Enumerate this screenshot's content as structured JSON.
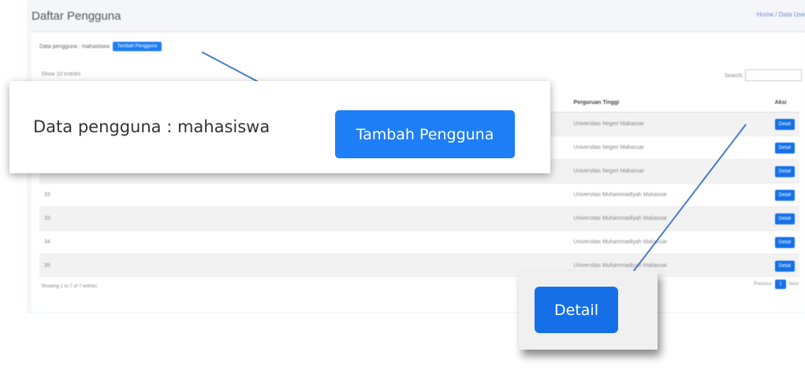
{
  "page": {
    "title": "Daftar Pengguna",
    "breadcrumb": "Home / Data Use"
  },
  "card": {
    "label": "Data pengguna : mahasiswa",
    "add_button": "Tambah Pengguna",
    "show_entries": "Show 10 entries",
    "search_label": "Search:",
    "search_value": ""
  },
  "table": {
    "headers": [
      "",
      "",
      "",
      "",
      "Perguruan Tinggi",
      "Aksi"
    ],
    "rows": [
      [
        "",
        "",
        "",
        "",
        "Universitas Negeri Makassar",
        "Detail"
      ],
      [
        "",
        "",
        "",
        "",
        "Universitas Negeri Makassar",
        "Detail"
      ],
      [
        "",
        "",
        "",
        "",
        "Universitas Negeri Makassar",
        "Detail"
      ],
      [
        "33",
        "",
        "",
        "",
        "Universitas Muhammadiyah Makassar",
        "Detail"
      ],
      [
        "33",
        "",
        "",
        "",
        "Universitas Muhammadiyah Makassar",
        "Detail"
      ],
      [
        "34",
        "",
        "",
        "",
        "Universitas Muhammadiyah Makassar",
        "Detail"
      ],
      [
        "35",
        "",
        "",
        "",
        "Universitas Muhammadiyah Makassar",
        "Detail"
      ]
    ]
  },
  "footer": {
    "showing": "Showing 1 to 7 of 7 entries",
    "prev": "Previous",
    "page": "1",
    "next": "Next"
  },
  "callouts": {
    "zoom_label": "Data pengguna : mahasiswa",
    "zoom_button": "Tambah Pengguna",
    "detail_button": "Detail"
  },
  "colors": {
    "primary": "#1e7ef5",
    "connector": "#4a7cc9"
  }
}
